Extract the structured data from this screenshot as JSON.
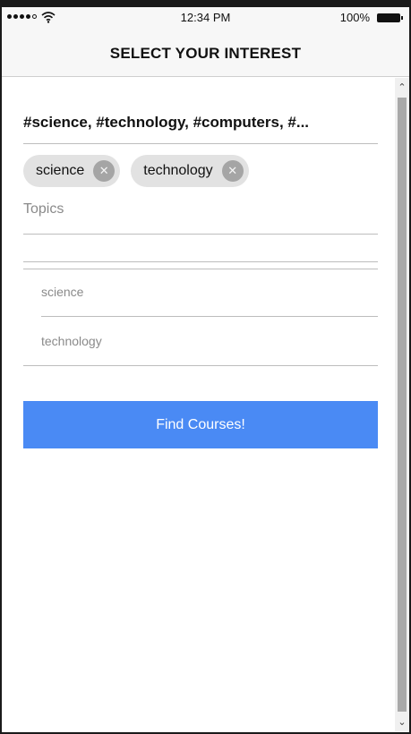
{
  "status_bar": {
    "time": "12:34 PM",
    "battery_percent": "100%",
    "signal_dots_filled": 4,
    "signal_dots_total": 5
  },
  "header": {
    "title": "SELECT YOUR INTEREST"
  },
  "main": {
    "hashtag_summary": "#science, #technology, #computers, #...",
    "chips": [
      {
        "label": "science",
        "remove_icon": "close-icon"
      },
      {
        "label": "technology",
        "remove_icon": "close-icon"
      }
    ],
    "topics_label": "Topics",
    "topics_input_value": "",
    "suggestions": [
      "science",
      "technology"
    ],
    "find_button_label": "Find Courses!"
  },
  "colors": {
    "accent": "#4a8af4",
    "chip_bg": "#e2e2e2",
    "scroll_thumb": "#a9a9a9"
  }
}
